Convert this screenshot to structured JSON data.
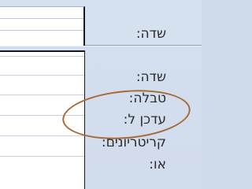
{
  "colors": {
    "panel_background": "#cfdaeb",
    "grid_background": "#ffffff",
    "grid_border": "#1a1a1a",
    "text": "#2b2b2b",
    "highlight_ellipse": "#a86a35"
  },
  "top_pane": {
    "field_label": "שדה:"
  },
  "bottom_pane": {
    "row_labels": [
      "שדה:",
      "טבלה:",
      "עדכן ל:",
      "קריטריונים:",
      "או:"
    ]
  },
  "annotation": {
    "highlighted_row": "עדכן ל:"
  }
}
